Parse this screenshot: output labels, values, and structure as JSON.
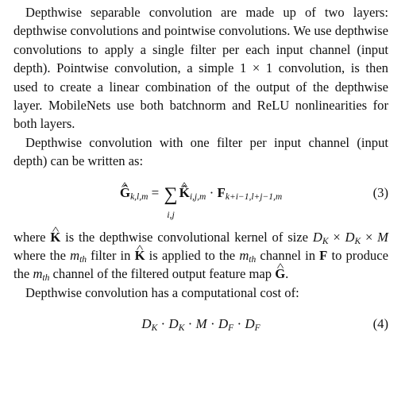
{
  "paragraphs": {
    "p1": "Depthwise separable convolution are made up of two layers: depthwise convolutions and pointwise convolutions. We use depthwise convolutions to apply a single filter per each input channel (input depth). Pointwise convolution, a simple",
    "p1_math": "1 × 1",
    "p1_tail": "convolution, is then used to create a linear combination of the output of the depthwise layer. MobileNets use both batchnorm and ReLU nonlinearities for both layers.",
    "p2": "Depthwise convolution with one filter per input channel (input depth) can be written as:",
    "p3_a": "where",
    "p3_b": "is the depthwise convolutional kernel of size",
    "p3_c": "where the",
    "p3_d": "filter in",
    "p3_e": "is applied to the",
    "p3_f": "channel in",
    "p3_g": "to produce the",
    "p3_h": "channel of the filtered output feature map",
    "p4": "Depthwise convolution has a computational cost of:"
  },
  "equations": {
    "eq3": {
      "lhs": "Ĝ",
      "lhs_sub": "k,l,m",
      "equals": "=",
      "sum_sub": "i,j",
      "k": "K̂",
      "k_sub": "i,j,m",
      "dot": "·",
      "f": "F",
      "f_sub": "k+i−1,l+j−1,m",
      "number": "(3)"
    },
    "eq4": {
      "expr": "D_K · D_K · M · D_F · D_F",
      "number": "(4)"
    }
  },
  "symbols": {
    "K": "K",
    "G": "G",
    "F": "F",
    "DK": "D",
    "K_sub": "K",
    "times": "×",
    "M": "M",
    "m": "m",
    "th": "th",
    "period": "."
  }
}
